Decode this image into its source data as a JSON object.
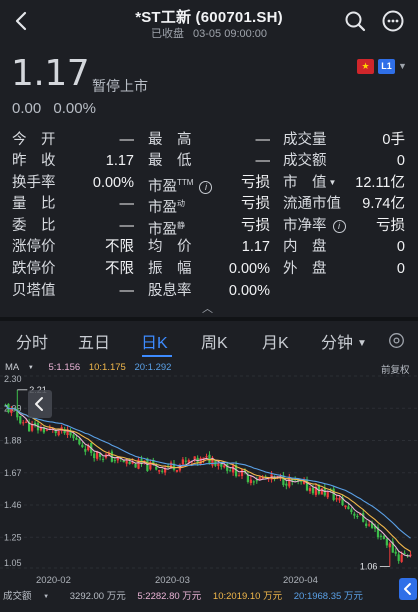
{
  "header": {
    "title": "*ST工新 (600701.SH)",
    "status": "已收盘",
    "datetime": "03-05 09:00:00"
  },
  "price": {
    "current": "1.17",
    "halt_status": "暂停上市",
    "change": "0.00",
    "change_pct": "0.00%"
  },
  "badges": {
    "flag": "★",
    "level": "L1"
  },
  "stats": [
    [
      {
        "label": "今　开",
        "value": "—"
      },
      {
        "label": "最　高",
        "value": "—"
      },
      {
        "label": "成交量",
        "value": "0手"
      }
    ],
    [
      {
        "label": "昨　收",
        "value": "1.17"
      },
      {
        "label": "最　低",
        "value": "—"
      },
      {
        "label": "成交额",
        "value": "0"
      }
    ],
    [
      {
        "label": "换手率",
        "value": "0.00%"
      },
      {
        "label": "市盈",
        "label_sup": "TTM",
        "value": "亏损"
      },
      {
        "label": "市　值",
        "value": "12.11亿"
      }
    ],
    [
      {
        "label": "量　比",
        "value": "—"
      },
      {
        "label": "市盈",
        "label_sup": "动",
        "value": "亏损"
      },
      {
        "label": "流通市值",
        "value": "9.74亿"
      }
    ],
    [
      {
        "label": "委　比",
        "value": "—"
      },
      {
        "label": "市盈",
        "label_sup": "静",
        "value": "亏损"
      },
      {
        "label": "市净率",
        "value": "亏损"
      }
    ],
    [
      {
        "label": "涨停价",
        "value": "不限"
      },
      {
        "label": "均　价",
        "value": "1.17"
      },
      {
        "label": "内　盘",
        "value": "0"
      }
    ],
    [
      {
        "label": "跌停价",
        "value": "不限"
      },
      {
        "label": "振　幅",
        "value": "0.00%"
      },
      {
        "label": "外　盘",
        "value": "0"
      }
    ],
    [
      {
        "label": "贝塔值",
        "value": "—"
      },
      {
        "label": "股息率",
        "value": "0.00%"
      }
    ]
  ],
  "tabs": [
    "分时",
    "五日",
    "日K",
    "周K",
    "月K",
    "分钟"
  ],
  "active_tab": "日K",
  "ma_legend": {
    "name": "MA",
    "ma5": "5:1.156",
    "ma10": "10:1.175",
    "ma20": "20:1.292",
    "fq": "前复权"
  },
  "chart_data": {
    "type": "candlestick",
    "y_ticks": [
      "2.30",
      "2.09",
      "1.88",
      "1.67",
      "1.46",
      "1.25",
      "1.05"
    ],
    "ylim": [
      1.05,
      2.3
    ],
    "high_label": "2.21",
    "low_label": "1.06",
    "x_ticks": [
      "2020-02",
      "2020-03",
      "2020-04"
    ],
    "colors": {
      "up": "#ef3b3b",
      "down": "#3cbe4a",
      "ma5": "#eab4d6",
      "ma10": "#f2b84b",
      "ma20": "#5aa0e6"
    }
  },
  "volume_legend": {
    "name": "成交额",
    "value": "3292.00 万元",
    "v5": "5:2282.80 万元",
    "v10": "10:2019.10 万元",
    "v20": "20:1968.35 万元"
  }
}
